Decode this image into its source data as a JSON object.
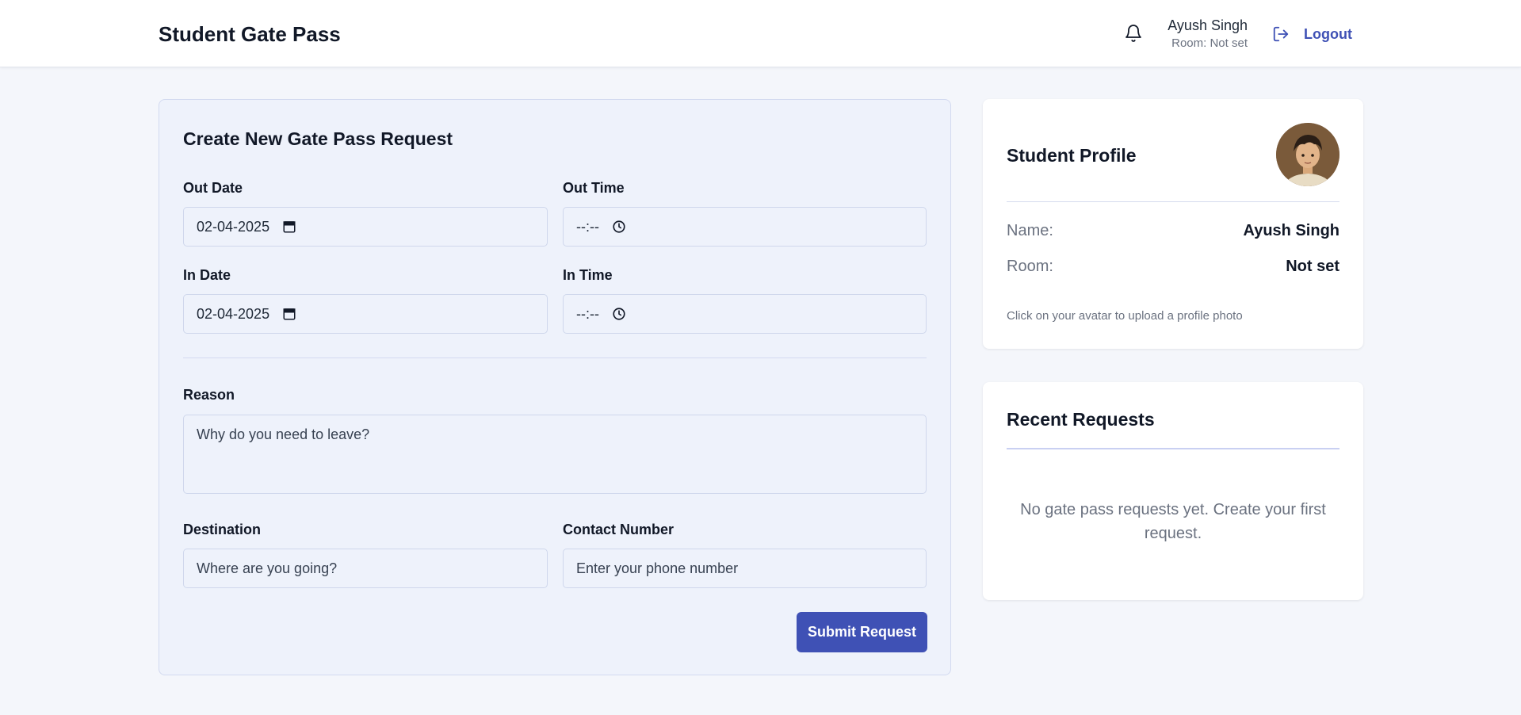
{
  "header": {
    "title": "Student Gate Pass",
    "user_name": "Ayush Singh",
    "user_room": "Room: Not set",
    "logout_label": "Logout",
    "icons": [
      "bell-icon",
      "logout-icon"
    ]
  },
  "form": {
    "title": "Create New Gate Pass Request",
    "out_date": {
      "label": "Out Date",
      "value": "02-04-2025"
    },
    "out_time": {
      "label": "Out Time",
      "value": "--:--"
    },
    "in_date": {
      "label": "In Date",
      "value": "02-04-2025"
    },
    "in_time": {
      "label": "In Time",
      "value": "--:--"
    },
    "reason": {
      "label": "Reason",
      "placeholder": "Why do you need to leave?"
    },
    "destination": {
      "label": "Destination",
      "placeholder": "Where are you going?"
    },
    "contact": {
      "label": "Contact Number",
      "placeholder": "Enter your phone number"
    },
    "submit_label": "Submit Request"
  },
  "profile": {
    "title": "Student Profile",
    "name_key": "Name:",
    "name_value": "Ayush Singh",
    "room_key": "Room:",
    "room_value": "Not set",
    "hint": "Click on your avatar to upload a profile photo"
  },
  "recent": {
    "title": "Recent Requests",
    "empty_message": "No gate pass requests yet. Create your first request."
  },
  "colors": {
    "accent": "#3f51b5",
    "page_bg": "#f4f6fb",
    "form_bg": "#eef2fb"
  }
}
